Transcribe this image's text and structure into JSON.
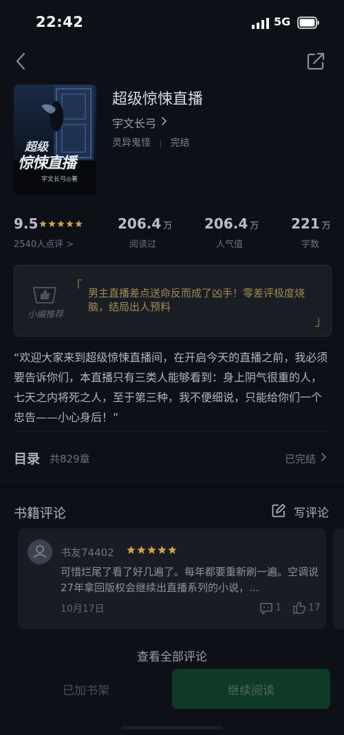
{
  "status_bar": {
    "time": "22:42",
    "network": "5G"
  },
  "book": {
    "title": "超级惊悚直播",
    "author": "宇文长弓",
    "genre": "灵异鬼怪",
    "status": "完结",
    "tags_separator": "|",
    "cover": {
      "title_line1": "超级",
      "title_line2": "惊悚直播",
      "author_credit": "宇文长弓◎著"
    }
  },
  "stats": {
    "rating": "9.5",
    "rating_count": "2540人点评 >",
    "reads": {
      "value": "206.4",
      "unit": "万",
      "label": "阅读过"
    },
    "popularity": {
      "value": "206.4",
      "unit": "万",
      "label": "人气值"
    },
    "words": {
      "value": "221",
      "unit": "万",
      "label": "字数"
    },
    "stars": 5
  },
  "recommendation": {
    "label": "小编推荐",
    "quote_open": "「",
    "quote_close": "」",
    "text": "男主直播差点送命反而成了凶手！零差评极度烧脑，结局出人预料"
  },
  "description": "“欢迎大家来到超级惊悚直播间，在开启今天的直播之前，我必须要告诉你们，本直播只有三类人能够看到：身上阴气很重的人，七天之内将死之人，至于第三种，我不便细说，只能给你们一个忠告——小心身后！”",
  "catalog": {
    "title": "目录",
    "count": "共829章",
    "status": "已完结"
  },
  "comments": {
    "title": "书籍评论",
    "write_label": "写评论",
    "items": [
      {
        "user": "书友74402",
        "stars": 5,
        "text": "可惜烂尾了看了好几遍了。每年都要重新刷一遍。空调说27年拿回版权会继续出直播系列的小说，...",
        "date": "10月17日",
        "replies": "1",
        "likes": "17"
      }
    ],
    "view_all": "查看全部评论"
  },
  "bottom_bar": {
    "shelf_label": "已加书架",
    "read_label": "继续阅读"
  },
  "colors": {
    "background": "#0d1117",
    "accent_gold": "#a08a52",
    "read_button": "#0f3a25",
    "star": "#c9a24a"
  }
}
